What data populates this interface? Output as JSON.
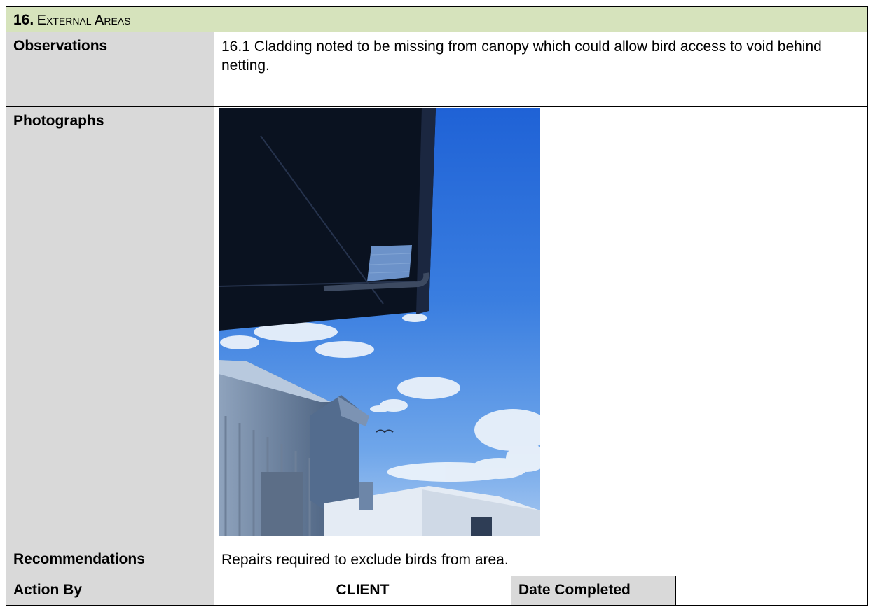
{
  "section": {
    "number": "16.",
    "title": "External Areas"
  },
  "rows": {
    "observations": {
      "label": "Observations",
      "text": "16.1 Cladding noted to be missing from canopy which could allow bird access to void behind netting."
    },
    "photographs": {
      "label": "Photographs",
      "photo": "canopy with missing cladding against blue sky, industrial buildings below"
    },
    "recommendations": {
      "label": "Recommendations",
      "text": "Repairs required to exclude birds from area."
    },
    "action": {
      "label": "Action By",
      "value": "CLIENT",
      "date_label": "Date Completed",
      "date_value": ""
    }
  },
  "colors": {
    "header_bg": "#d6e3bc",
    "label_bg": "#d9d9d9",
    "border": "#000000"
  }
}
